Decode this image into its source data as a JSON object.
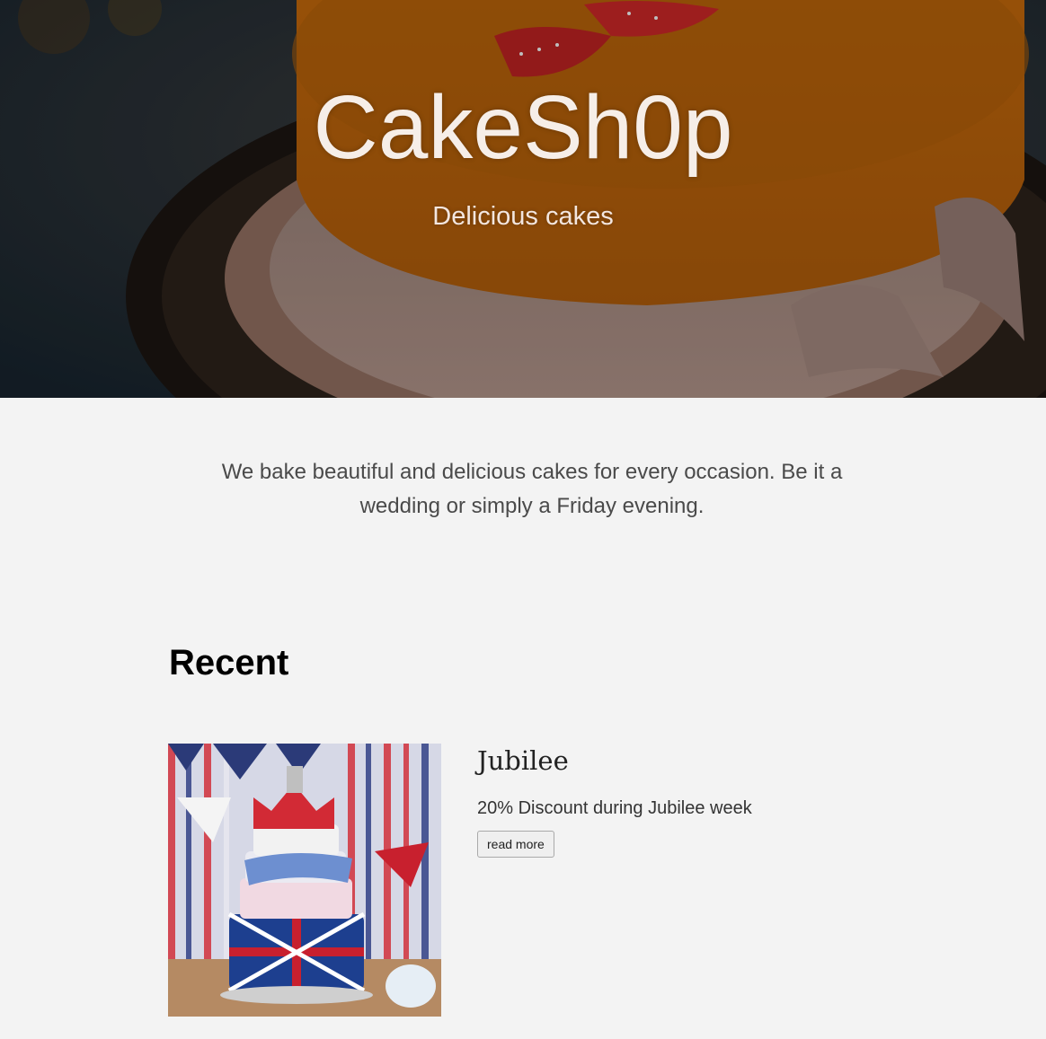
{
  "hero": {
    "title": "CakeSh0p",
    "subtitle": "Delicious cakes",
    "image_icon": "cake-photo"
  },
  "intro": {
    "text": "We bake beautiful and delicious cakes for every occasion. Be it a wedding or simply a Friday evening."
  },
  "recent": {
    "heading": "Recent",
    "posts": [
      {
        "title": "Jubilee",
        "text": "20% Discount during Jubilee week",
        "button_label": "read more",
        "image_icon": "jubilee-cake-photo"
      }
    ]
  },
  "colors": {
    "page_background": "#f3f3f3",
    "hero_overlay": "#1c2a33",
    "cake_orange": "#c8700f",
    "title_text": "#f6eee8"
  }
}
